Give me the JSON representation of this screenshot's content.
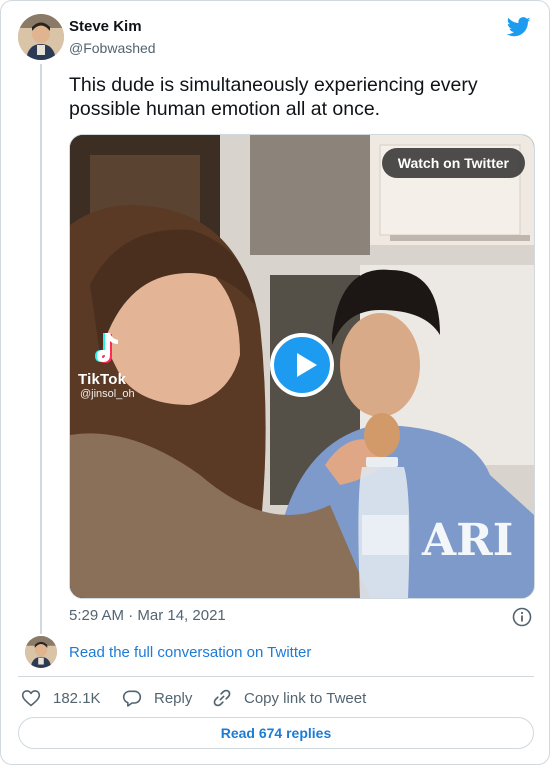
{
  "author": {
    "name": "Steve Kim",
    "handle": "@Fobwashed"
  },
  "tweet": {
    "text": "This dude is simultaneously experiencing every possible human emotion all at once.",
    "timestamp": "5:29 AM · Mar 14, 2021"
  },
  "media": {
    "watch_label": "Watch on Twitter",
    "tiktok_brand": "TikTok",
    "tiktok_user": "@jinsol_oh"
  },
  "conversation": {
    "link_text": "Read the full conversation on Twitter"
  },
  "actions": {
    "likes": "182.1K",
    "reply_label": "Reply",
    "copy_label": "Copy link to Tweet"
  },
  "replies_button": "Read 674 replies",
  "colors": {
    "twitter_blue": "#1d9bf0",
    "link_blue": "#1d7bd6",
    "muted_text": "#536471",
    "border": "#cfd9de"
  }
}
